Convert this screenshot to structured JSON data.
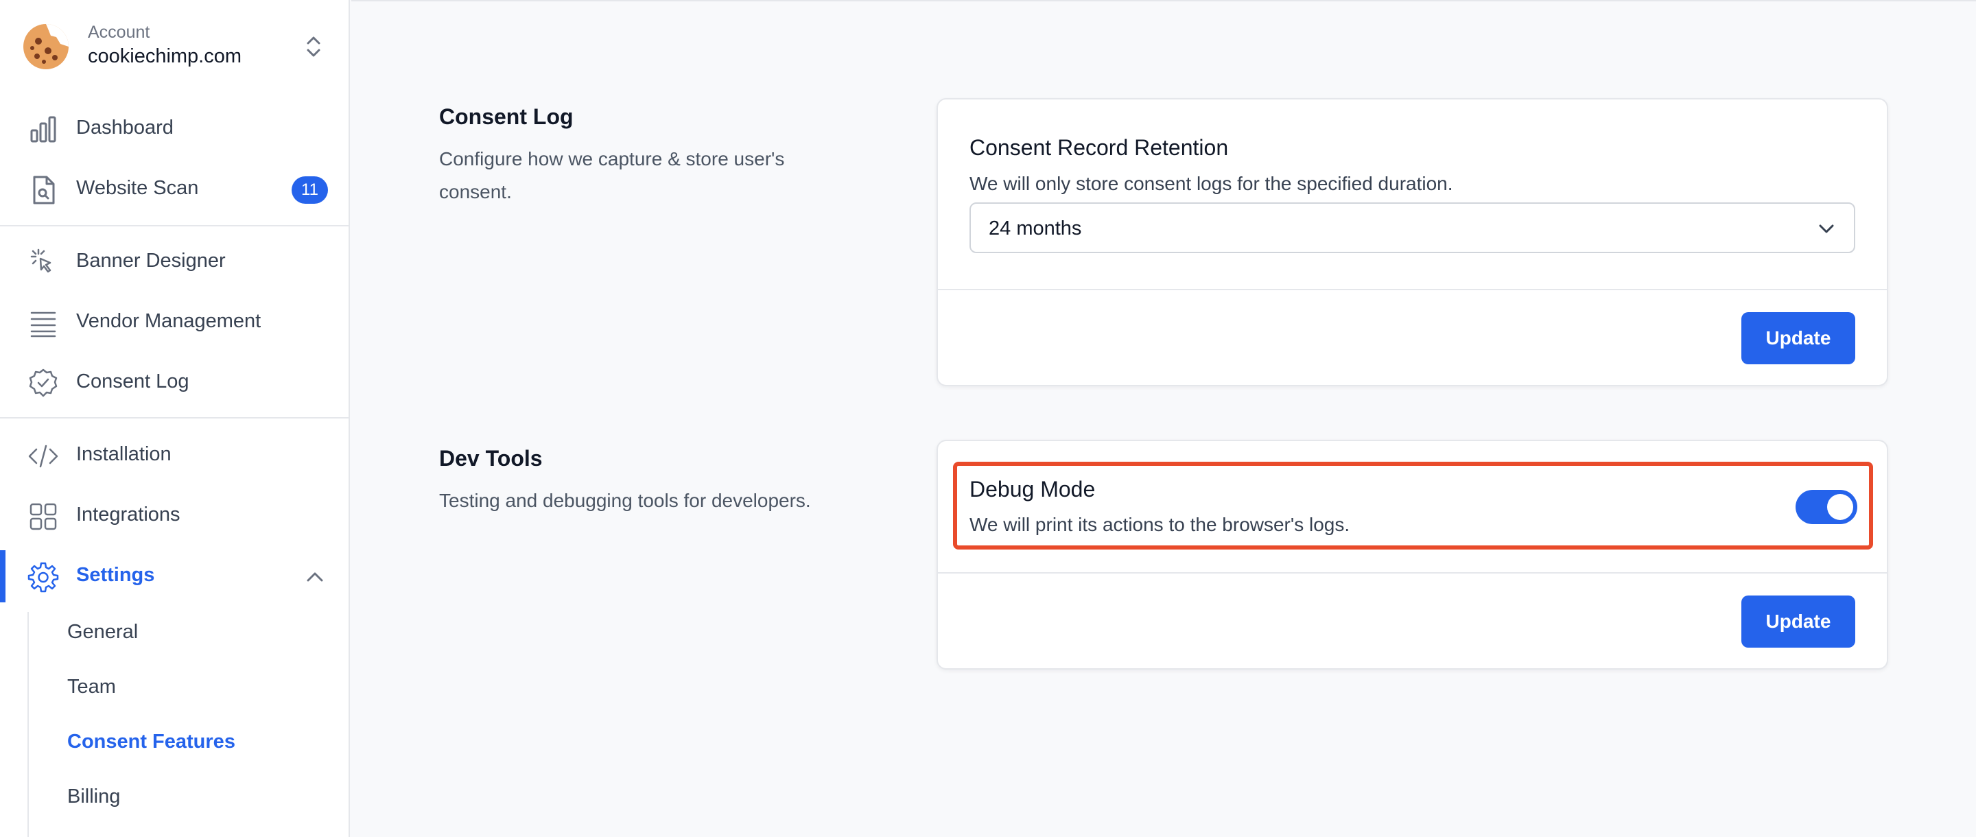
{
  "account": {
    "label": "Account",
    "name": "cookiechimp.com"
  },
  "sidebar": {
    "items": [
      {
        "label": "Dashboard",
        "icon": "bar-chart-icon"
      },
      {
        "label": "Website Scan",
        "icon": "document-search-icon",
        "badge": "11"
      },
      {
        "label": "Banner Designer",
        "icon": "cursor-click-icon"
      },
      {
        "label": "Vendor Management",
        "icon": "list-lines-icon"
      },
      {
        "label": "Consent Log",
        "icon": "check-badge-icon"
      },
      {
        "label": "Installation",
        "icon": "code-icon"
      },
      {
        "label": "Integrations",
        "icon": "grid-icon"
      },
      {
        "label": "Settings",
        "icon": "gear-icon",
        "active": true,
        "expanded": true
      }
    ],
    "settings_subitems": [
      {
        "label": "General"
      },
      {
        "label": "Team"
      },
      {
        "label": "Consent Features",
        "active": true
      },
      {
        "label": "Billing"
      }
    ]
  },
  "sections": {
    "consent_log": {
      "title": "Consent Log",
      "description": "Configure how we capture & store user's consent.",
      "card": {
        "title": "Consent Record Retention",
        "description": "We will only store consent logs for the specified duration.",
        "select_value": "24 months",
        "button": "Update"
      }
    },
    "dev_tools": {
      "title": "Dev Tools",
      "description": "Testing and debugging tools for developers.",
      "card": {
        "title": "Debug Mode",
        "description": "We will print its actions to the browser's logs.",
        "toggle_on": true,
        "button": "Update"
      }
    }
  },
  "colors": {
    "accent": "#2563eb",
    "highlight_border": "#e94b2b",
    "background": "#f8f9fb"
  }
}
